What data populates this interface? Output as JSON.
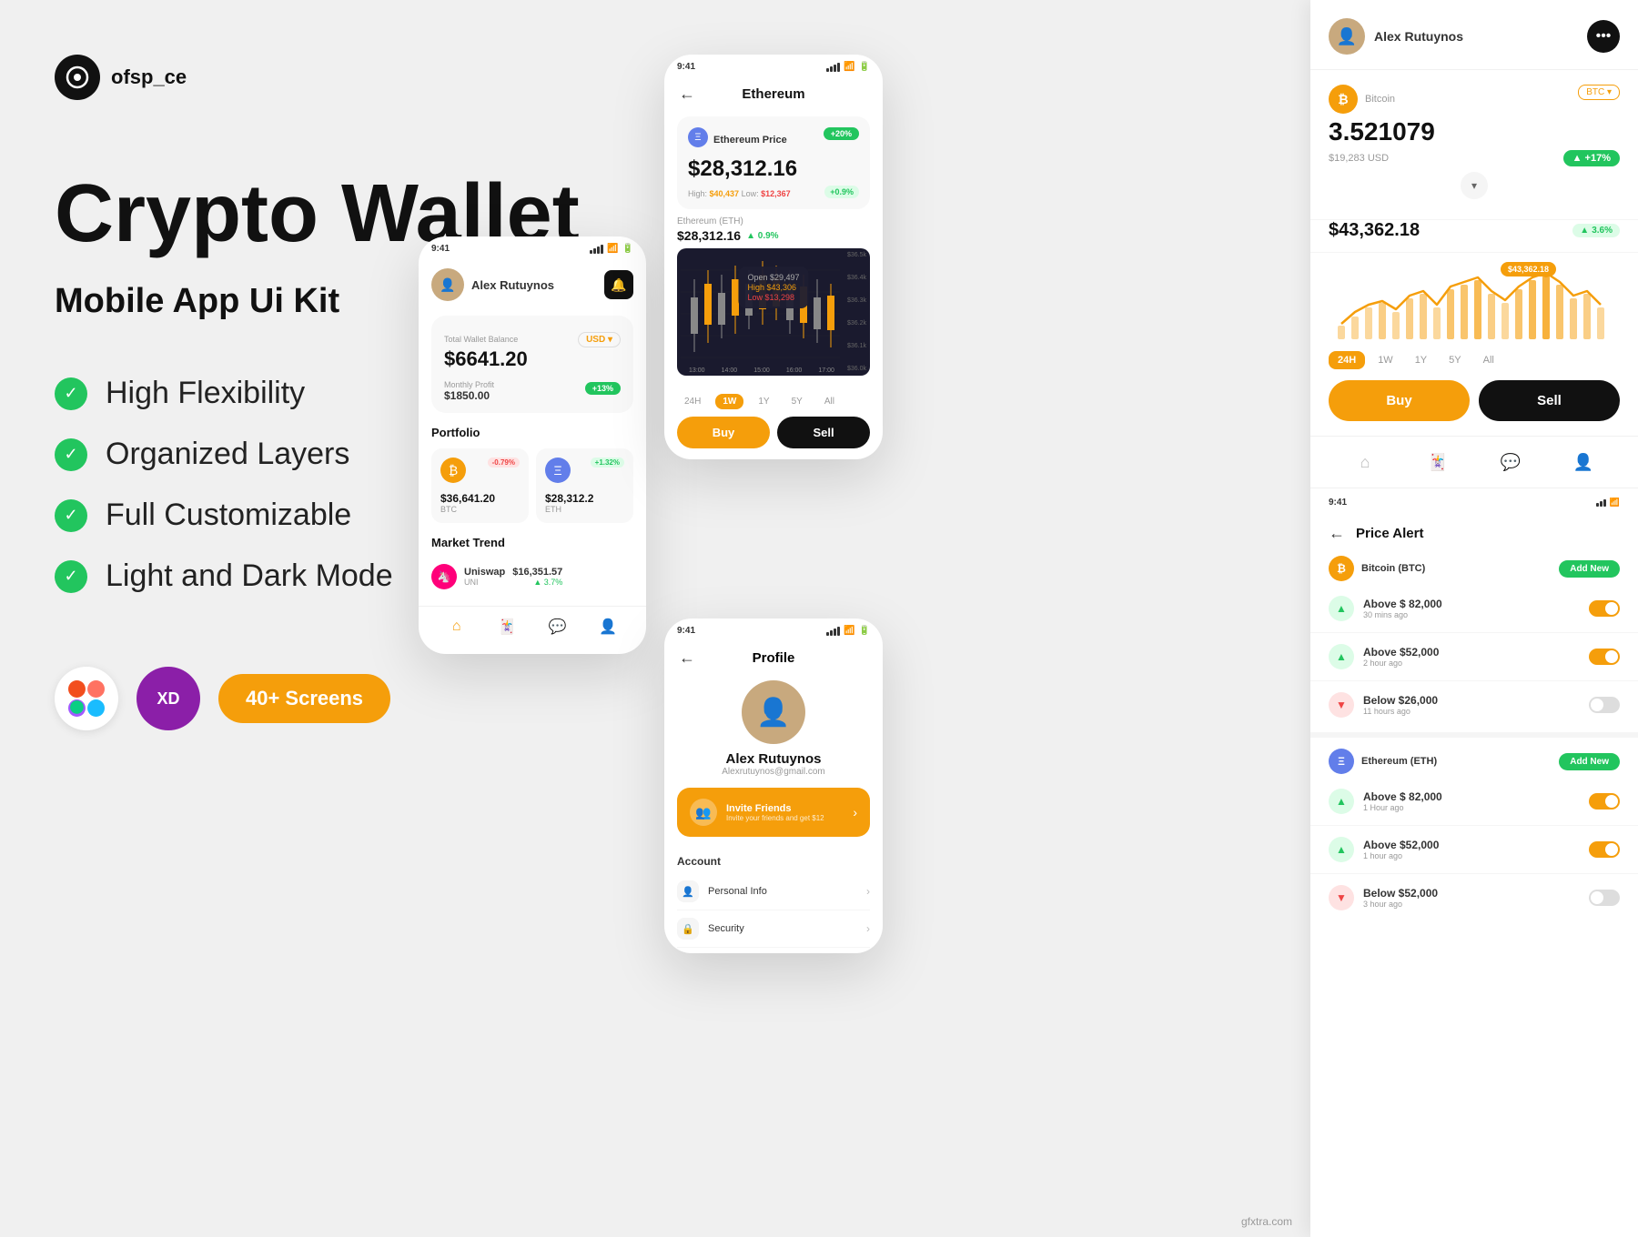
{
  "logo": {
    "symbol": "○",
    "text": "ofsp_ce"
  },
  "hero": {
    "title": "Crypto Wallet",
    "subtitle": "Mobile App Ui Kit"
  },
  "features": [
    {
      "id": "flexibility",
      "text": "High Flexibility"
    },
    {
      "id": "layers",
      "text": "Organized Layers"
    },
    {
      "id": "customizable",
      "text": "Full Customizable"
    },
    {
      "id": "darkmode",
      "text": "Light and Dark Mode"
    }
  ],
  "tools": {
    "figma_label": "Figma",
    "xd_label": "XD",
    "screens_label": "40+ Screens"
  },
  "phone_main": {
    "time": "9:41",
    "user": "Alex Rutuynos",
    "total_wallet_label": "Total Wallet Balance",
    "currency": "USD",
    "balance": "$6641.20",
    "monthly_profit_label": "Monthly Profit",
    "profit": "$1850.00",
    "profit_badge": "+13%",
    "portfolio_title": "Portfolio",
    "btc_label": "Bitcoin",
    "btc_badge": "-0.79%",
    "btc_price": "$36,641.20",
    "btc_symbol": "BTC",
    "eth_label": "Ethereum",
    "eth_badge": "+1.32%",
    "eth_price": "$28,312.2",
    "eth_symbol": "ETH",
    "market_title": "Market Trend",
    "uni_name": "Uniswap",
    "uni_symbol": "UNI",
    "uni_price": "$16,351.57",
    "uni_change": "3.7%"
  },
  "phone_eth": {
    "time": "9:41",
    "title": "Ethereum",
    "coin_label": "Ethereum Price",
    "badge_20": "+20%",
    "badge_09": "+0.9%",
    "main_price": "$28,312.16",
    "high_label": "High:",
    "high_value": "$40,437",
    "low_label": "Low:",
    "low_value": "$12,367",
    "eth_label": "Ethereum (ETH)",
    "eth_price": "$28,312.16",
    "eth_up": "0.9%",
    "open": "$29,497",
    "high": "$43,306",
    "low": "$13,298",
    "y_labels": [
      "$36.5k",
      "$36.4k",
      "$36.3k",
      "$36.2k",
      "$36.1k",
      "$36.0k"
    ],
    "x_labels": [
      "13:00",
      "14:00",
      "15:00",
      "16:00",
      "17:00"
    ],
    "time_filters": [
      "24H",
      "1W",
      "1Y",
      "5Y",
      "All"
    ],
    "active_filter": "1W",
    "buy_label": "Buy",
    "sell_label": "Sell"
  },
  "phone_profile": {
    "time": "9:41",
    "title": "Profile",
    "name": "Alex Rutuynos",
    "email": "Alexrutuynos@gmail.com",
    "invite_title": "Invite Friends",
    "invite_sub": "Invite your friends and get $12",
    "account_title": "Account"
  },
  "right_panel": {
    "user": "Alex Rutuynos",
    "btc_name": "Bitcoin",
    "btc_code": "BTC ▾",
    "btc_price": "3.521079",
    "btc_usd": "$19,283 USD",
    "btc_badge": "+17%",
    "btc_price2": "$43,362.18",
    "btc_badge2": "3.6%",
    "chart_tooltip": "$43,362.18",
    "time_tabs": [
      "24H",
      "1W",
      "1Y",
      "5Y",
      "All"
    ],
    "active_tab": "24H",
    "buy_label": "Buy",
    "sell_label": "Sell",
    "alert_title": "Price Alert",
    "alert_time": "9:41",
    "btc_alert_name": "Bitcoin (BTC)",
    "add_new": "Add New",
    "alerts": [
      {
        "direction": "up",
        "price": "Above $ 82,000",
        "time": "30 mins ago",
        "on": true
      },
      {
        "direction": "up",
        "price": "Above $52,000",
        "time": "2 hour ago",
        "on": true
      },
      {
        "direction": "down",
        "price": "Below $26,000",
        "time": "11 hours ago",
        "on": false
      }
    ],
    "eth_alert_name": "Ethereum (ETH)",
    "add_new_eth": "Add New",
    "eth_alerts": [
      {
        "direction": "up",
        "price": "Above $ 82,000",
        "time": "1 Hour ago",
        "on": true
      },
      {
        "direction": "up",
        "price": "Above $52,000",
        "time": "1 hour ago",
        "on": true
      }
    ]
  },
  "watermark": "gfxtra.com"
}
